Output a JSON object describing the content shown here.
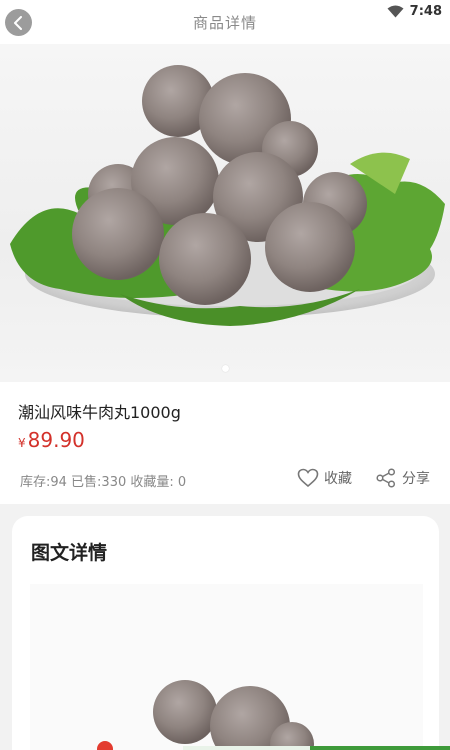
{
  "header": {
    "title": "商品详情",
    "back_icon": "back-arrow-icon"
  },
  "status_bar": {
    "time": "7:48",
    "wifi_icon": "wifi-icon"
  },
  "hero": {
    "image": "beef-meatballs-on-lettuce-plate",
    "pagination": {
      "current": 1,
      "total": 1
    }
  },
  "product": {
    "name": "潮汕风味牛肉丸1000g",
    "currency": "¥",
    "price": "89.90",
    "stats": "库存:94 已售:330 收藏量: 0",
    "favorite_label": "收藏",
    "share_label": "分享"
  },
  "details": {
    "title": "图文详情",
    "image": "beef-meatballs-detail"
  },
  "colors": {
    "price": "#d3312a",
    "accent_green": "#3e9a3a",
    "badge": "#e33b2f"
  }
}
